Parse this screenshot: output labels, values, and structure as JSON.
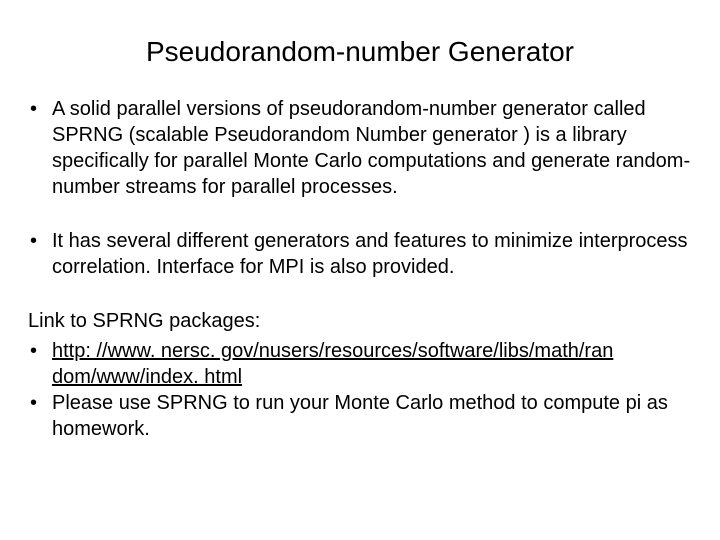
{
  "title": "Pseudorandom-number Generator",
  "bullet1": "A solid parallel versions of pseudorandom-number generator called SPRNG (scalable Pseudorandom Number generator ) is a library specifically for parallel Monte Carlo computations and generate random-number streams for parallel processes.",
  "bullet2": "It has several different generators and features to minimize interprocess correlation. Interface for MPI is also provided.",
  "link_label": "Link to SPRNG packages:",
  "link_url_part1": "http: //www. nersc. gov/nusers/resources/software/libs/math/ran",
  "link_url_part2": "dom/www/index. html",
  "homework": "Please use SPRNG to run your Monte Carlo method to compute pi as homework."
}
